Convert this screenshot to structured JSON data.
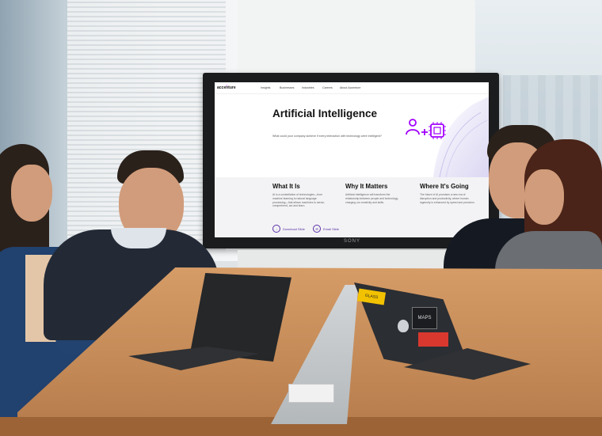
{
  "tv": {
    "brand": "SONY",
    "site": {
      "logo": "accenture",
      "logo_mark": ">",
      "nav": [
        "Insights",
        "Businesses",
        "Industries",
        "Careers",
        "About Accenture"
      ],
      "hero_title": "Artificial Intelligence",
      "hero_subtitle": "What could your company achieve if every interaction with technology were intelligent?",
      "columns": [
        {
          "title": "What It Is",
          "text": "AI is a constellation of technologies—from machine learning to natural language processing—that allows machines to sense, comprehend, act and learn."
        },
        {
          "title": "Why It Matters",
          "text": "Artificial intelligence will transform the relationship between people and technology, charging our creativity and skills."
        },
        {
          "title": "Where It's Going",
          "text": "The future of AI promises a new era of disruption and productivity, where human ingenuity is enhanced by speed and precision."
        }
      ],
      "ctas": [
        {
          "label": "Download Slide",
          "icon": "download-icon"
        },
        {
          "label": "Email Slide",
          "icon": "email-icon"
        }
      ]
    }
  },
  "laptop_right": {
    "stickers": [
      "GLASS",
      "MAPS",
      "apple-logo"
    ]
  },
  "colors": {
    "accent": "#a100ff",
    "cta": "#5a2ea6",
    "table": "#c48a57"
  }
}
